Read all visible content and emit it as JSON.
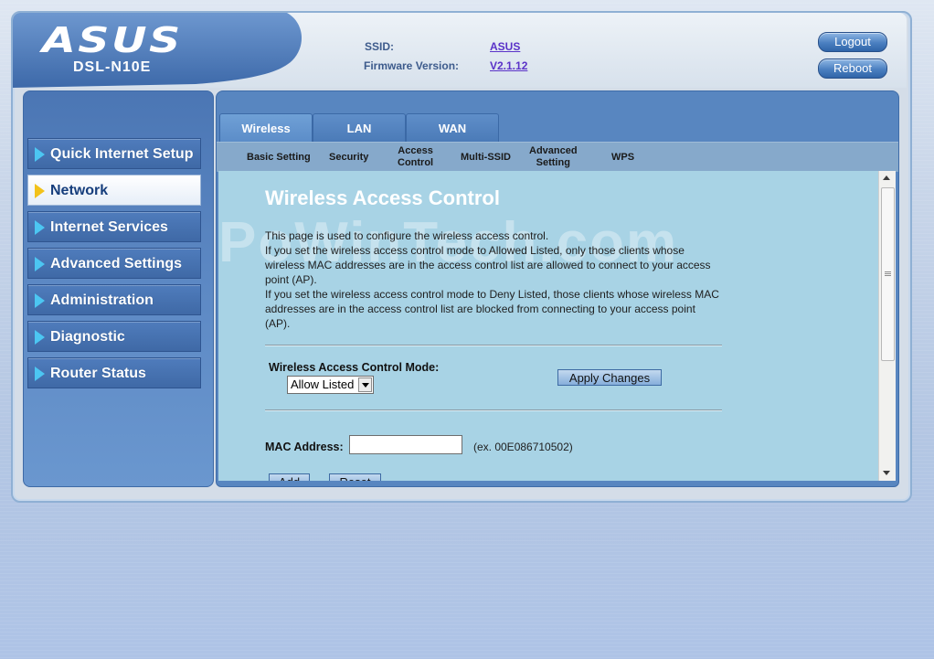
{
  "header": {
    "logo": "ASUS",
    "model": "DSL-N10E",
    "ssid_label": "SSID:",
    "ssid_value": "ASUS",
    "firmware_label": "Firmware Version:",
    "firmware_value": "V2.1.12",
    "logout_label": "Logout",
    "reboot_label": "Reboot"
  },
  "sidebar": {
    "items": [
      {
        "label": "Quick Internet Setup",
        "active": false
      },
      {
        "label": "Network",
        "active": true
      },
      {
        "label": "Internet Services",
        "active": false
      },
      {
        "label": "Advanced Settings",
        "active": false
      },
      {
        "label": "Administration",
        "active": false
      },
      {
        "label": "Diagnostic",
        "active": false
      },
      {
        "label": "Router Status",
        "active": false
      }
    ]
  },
  "tabs": [
    {
      "label": "Wireless",
      "active": true
    },
    {
      "label": "LAN",
      "active": false
    },
    {
      "label": "WAN",
      "active": false
    }
  ],
  "subtabs": [
    {
      "line1": "Basic Setting",
      "line2": ""
    },
    {
      "line1": "Security",
      "line2": ""
    },
    {
      "line1": "Access",
      "line2": "Control"
    },
    {
      "line1": "Multi-SSID",
      "line2": ""
    },
    {
      "line1": "Advanced",
      "line2": "Setting"
    },
    {
      "line1": "WPS",
      "line2": ""
    }
  ],
  "main": {
    "watermark": "PoWinTech.com",
    "title": "Wireless Access Control",
    "description": [
      "This page is used to configure the wireless access control.",
      "If you set the wireless access control mode to Allowed Listed, only those clients whose wireless MAC addresses are in the access control list are allowed to connect to your access point (AP).",
      "If you set the wireless access control mode to Deny Listed, those clients whose wireless MAC addresses are in the access control list are blocked from connecting to your access point (AP)."
    ],
    "mode_label": "Wireless Access Control Mode:",
    "mode_value": "Allow Listed",
    "apply_label": "Apply Changes",
    "mac_label": "MAC Address:",
    "mac_value": "",
    "mac_hint": "(ex. 00E086710502)",
    "add_label": "Add",
    "reset_label": "Reset"
  },
  "colors": {
    "sidebar_bg": "#4b76b4",
    "panel_bg": "#a8d3e5",
    "active_arrow": "#f2c21a",
    "inactive_arrow": "#4cc6f2",
    "link": "#5a32c8"
  }
}
